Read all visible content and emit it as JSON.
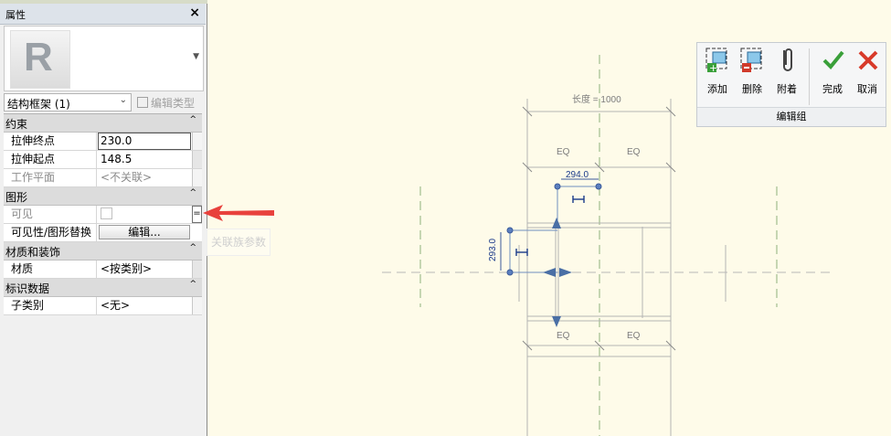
{
  "properties_panel": {
    "title": "属性",
    "close_glyph": "×",
    "type_selector": {
      "value": "结构框架 (1)",
      "chevron": "⌄"
    },
    "edit_type_label": "编辑类型",
    "groups": {
      "constraints": {
        "label": "约束",
        "rows": [
          {
            "name": "拉伸终点",
            "value": "230.0"
          },
          {
            "name": "拉伸起点",
            "value": "148.5"
          },
          {
            "name": "工作平面",
            "value": "<不关联>"
          }
        ]
      },
      "graphics": {
        "label": "图形",
        "rows": [
          {
            "name": "可见",
            "value": ""
          },
          {
            "name": "可见性/图形替换",
            "value": "编辑..."
          }
        ],
        "assoc_button": "="
      },
      "materials": {
        "label": "材质和装饰",
        "rows": [
          {
            "name": "材质",
            "value": "<按类别>"
          }
        ]
      },
      "identity": {
        "label": "标识数据",
        "rows": [
          {
            "name": "子类别",
            "value": "<无>"
          }
        ]
      }
    },
    "collapse_glyph": "^"
  },
  "ghost_tooltip": "关联族参数",
  "ribbon": {
    "buttons": {
      "add": "添加",
      "remove": "删除",
      "attach": "附着",
      "finish": "完成",
      "cancel": "取消"
    },
    "group_label": "编辑组"
  },
  "canvas": {
    "dimensions": {
      "length": "长度 = 1000",
      "eq_top_left": "EQ",
      "eq_top_right": "EQ",
      "eq_bottom_left": "EQ",
      "eq_bottom_right": "EQ",
      "width_value": "294.0",
      "height_value": "293.0"
    }
  },
  "colors": {
    "canvas_bg": "#fefbe9",
    "arrow_red": "#e8413c",
    "handle_blue": "#4a6fa5"
  }
}
